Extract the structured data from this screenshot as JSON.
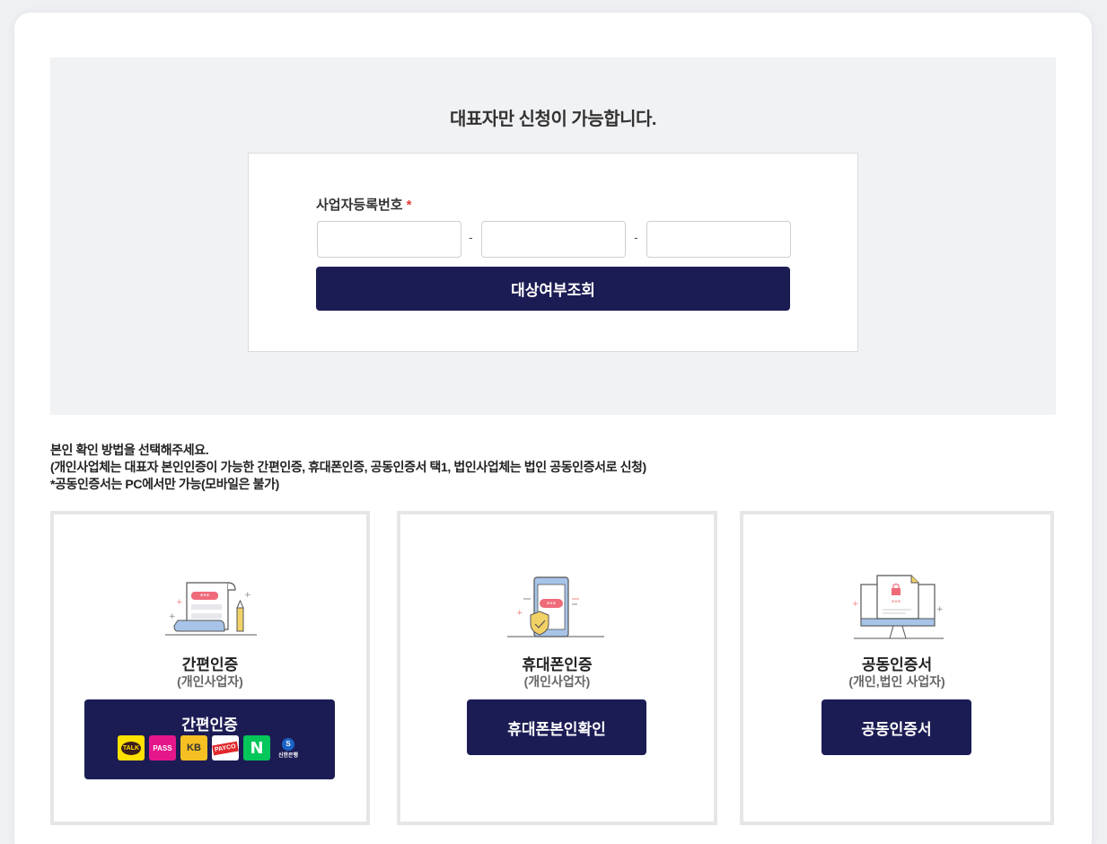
{
  "check": {
    "title": "대표자만 신청이 가능합니다.",
    "brn_label": "사업자등록번호",
    "required_mark": "*",
    "separator": "-",
    "brn_fields": [
      "",
      "",
      ""
    ],
    "lookup_button": "대상여부조회"
  },
  "notice": {
    "line1": "본인 확인 방법을 선택해주세요.",
    "line2": "(개인사업체는 대표자 본인인증이 가능한 간편인증, 휴대폰인증, 공동인증서 택1, 법인사업체는 법인 공동인증서로 신청)",
    "line3": "*공동인증서는 PC에서만 가능(모바일은 불가)"
  },
  "methods": [
    {
      "title": "간편인증",
      "subtitle": "(개인사업자)",
      "button": "간편인증",
      "icon": "document-scroll-icon",
      "providers": [
        {
          "name": "kakao-icon",
          "label": "TALK"
        },
        {
          "name": "pass-icon",
          "label": "PASS"
        },
        {
          "name": "kb-icon",
          "label": "KB"
        },
        {
          "name": "payco-icon",
          "label": "PAYCO"
        },
        {
          "name": "naver-icon",
          "label": "N"
        },
        {
          "name": "shinhan-icon",
          "label": "신한은행"
        }
      ]
    },
    {
      "title": "휴대폰인증",
      "subtitle": "(개인사업자)",
      "button": "휴대폰본인확인",
      "icon": "smartphone-shield-icon"
    },
    {
      "title": "공동인증서",
      "subtitle": "(개인,법인 사업자)",
      "button": "공동인증서",
      "icon": "monitor-certificate-icon"
    }
  ],
  "colors": {
    "primary": "#1c1c55",
    "required": "#e53935",
    "panel_bg": "#f1f2f4"
  }
}
